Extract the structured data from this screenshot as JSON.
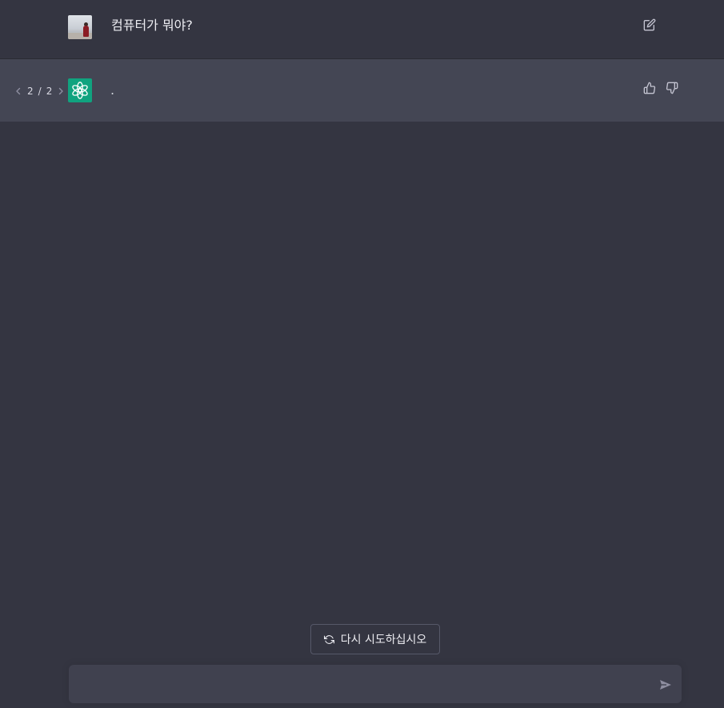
{
  "conversation": {
    "user_message": "컴퓨터가 뭐야?",
    "assistant_message": ".",
    "pager": {
      "current": "2",
      "separator": "/",
      "total": "2"
    }
  },
  "icons": {
    "edit": "edit-icon",
    "prev": "chevron-left-icon",
    "next": "chevron-right-icon",
    "thumbs_up": "thumbs-up-icon",
    "thumbs_down": "thumbs-down-icon",
    "regenerate": "refresh-icon",
    "send": "send-icon",
    "assistant_logo": "openai-logo-icon"
  },
  "actions": {
    "regenerate_label": "다시 시도하십시오"
  },
  "composer": {
    "value": "",
    "placeholder": ""
  },
  "colors": {
    "background": "#343541",
    "assistant_row": "#444654",
    "accent": "#10a37f",
    "input_bg": "#40414f"
  }
}
